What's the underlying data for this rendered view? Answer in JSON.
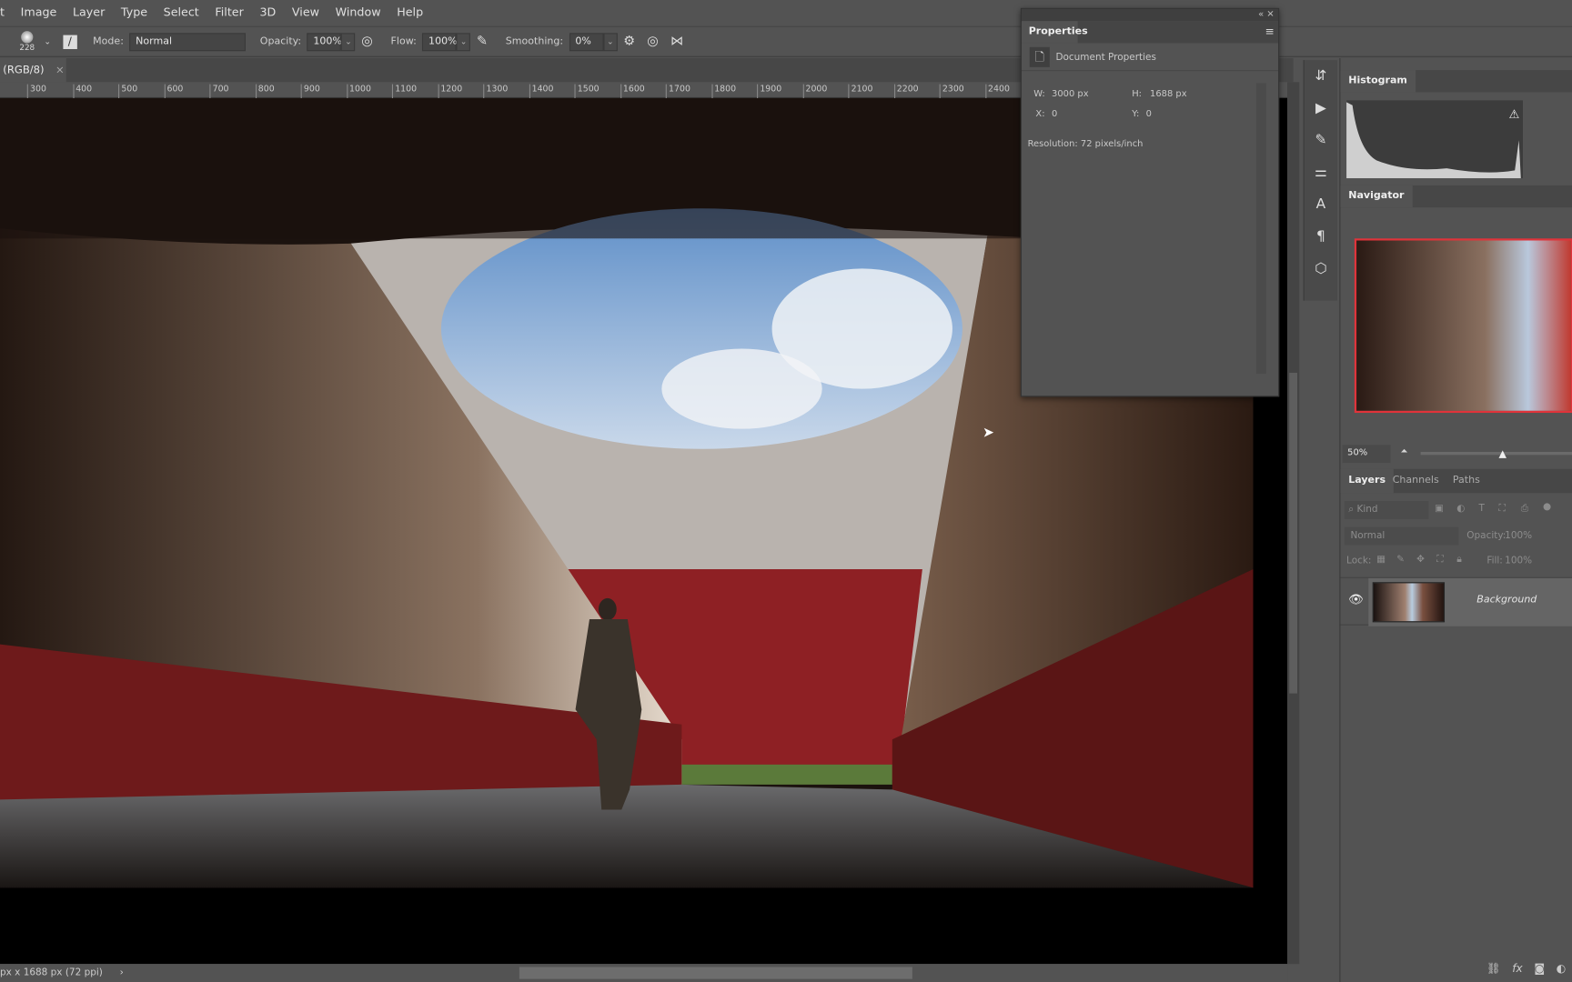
{
  "menu": [
    "t",
    "Image",
    "Layer",
    "Type",
    "Select",
    "Filter",
    "3D",
    "View",
    "Window",
    "Help"
  ],
  "options": {
    "brush_size": "228",
    "mode_label": "Mode:",
    "mode_value": "Normal",
    "opacity_label": "Opacity:",
    "opacity_value": "100%",
    "flow_label": "Flow:",
    "flow_value": "100%",
    "smoothing_label": "Smoothing:",
    "smoothing_value": "0%"
  },
  "document_tab": {
    "title": "(RGB/8)",
    "close": "×"
  },
  "ruler_ticks": [
    "300",
    "400",
    "500",
    "600",
    "700",
    "800",
    "900",
    "1000",
    "1100",
    "1200",
    "1300",
    "1400",
    "1500",
    "1600",
    "1700",
    "1800",
    "1900",
    "2000",
    "2100",
    "2200",
    "2300",
    "2400"
  ],
  "status": {
    "text": "px x 1688 px (72 ppi)",
    "arrow": "›"
  },
  "properties": {
    "title": "Properties",
    "section": "Document Properties",
    "w_label": "W:",
    "w_value": "3000 px",
    "h_label": "H:",
    "h_value": "1688 px",
    "x_label": "X:",
    "x_value": "0",
    "y_label": "Y:",
    "y_value": "0",
    "resolution": "Resolution: 72 pixels/inch"
  },
  "panels": {
    "histogram": "Histogram",
    "navigator": "Navigator",
    "zoom": "50%"
  },
  "layers": {
    "tabs": [
      "Layers",
      "Channels",
      "Paths"
    ],
    "filter": "Kind",
    "blend": "Normal",
    "opacity_label": "Opacity:",
    "opacity_value": "100%",
    "lock_label": "Lock:",
    "fill_label": "Fill:",
    "fill_value": "100%",
    "items": [
      {
        "name": "Background",
        "visible": true
      }
    ]
  },
  "colors": {
    "ui_bg": "#535353",
    "navigator_frame": "#e0333a"
  }
}
